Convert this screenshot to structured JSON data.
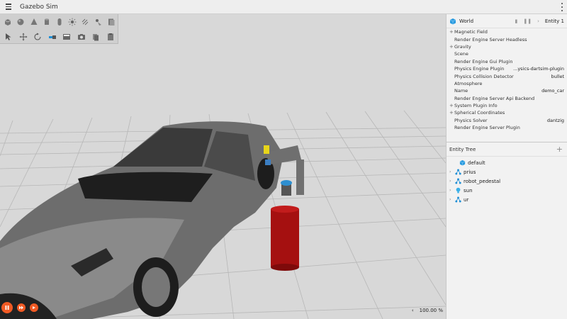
{
  "app": {
    "title": "Gazebo Sim"
  },
  "toolbar": {
    "row1": [
      "box-icon",
      "sphere-icon",
      "cone-icon",
      "cylinder-icon",
      "capsule-icon",
      "sun-light-icon",
      "directional-light-icon",
      "spot-light-icon",
      "ellipsoid-icon"
    ],
    "row2": [
      "select-icon",
      "translate-icon",
      "rotate-icon",
      "align-icon",
      "grid-icon",
      "screenshot-icon",
      "copy-icon",
      "paste-icon"
    ]
  },
  "component_inspector": {
    "header": {
      "title": "World",
      "entity_label": "Entity 1"
    },
    "rows": [
      {
        "label": "Magnetic Field",
        "value": "",
        "expandable": true
      },
      {
        "label": "Render Engine Server Headless",
        "value": "",
        "expandable": false
      },
      {
        "label": "Gravity",
        "value": "",
        "expandable": true
      },
      {
        "label": "Scene",
        "value": "",
        "expandable": false
      },
      {
        "label": "Render Engine Gui Plugin",
        "value": "",
        "expandable": false
      },
      {
        "label": "Physics Engine Plugin",
        "value": "...ysics-dartsim-plugin",
        "expandable": false
      },
      {
        "label": "Physics Collision Detector",
        "value": "bullet",
        "expandable": false
      },
      {
        "label": "Atmosphere",
        "value": "",
        "expandable": false
      },
      {
        "label": "Name",
        "value": "demo_car",
        "expandable": false
      },
      {
        "label": "Render Engine Server Api Backend",
        "value": "",
        "expandable": false
      },
      {
        "label": "System Plugin Info",
        "value": "",
        "expandable": true
      },
      {
        "label": "Spherical Coordinates",
        "value": "",
        "expandable": true
      },
      {
        "label": "Physics Solver",
        "value": "dantzig",
        "expandable": false
      },
      {
        "label": "Render Engine Server Plugin",
        "value": "",
        "expandable": false
      }
    ]
  },
  "entity_tree": {
    "title": "Entity Tree",
    "items": [
      {
        "name": "default",
        "icon": "world-icon",
        "expandable": false
      },
      {
        "name": "prius",
        "icon": "model-icon",
        "expandable": true
      },
      {
        "name": "robot_pedestal",
        "icon": "model-icon",
        "expandable": true
      },
      {
        "name": "sun",
        "icon": "light-icon",
        "expandable": true
      },
      {
        "name": "ur",
        "icon": "model-icon",
        "expandable": true
      }
    ]
  },
  "playback": {
    "rtf_arrow": "‹",
    "rtf": "100.00 %"
  },
  "colors": {
    "accent": "#f15a24",
    "model_icon": "#1e8fd6",
    "light_icon": "#3ab0e8"
  }
}
